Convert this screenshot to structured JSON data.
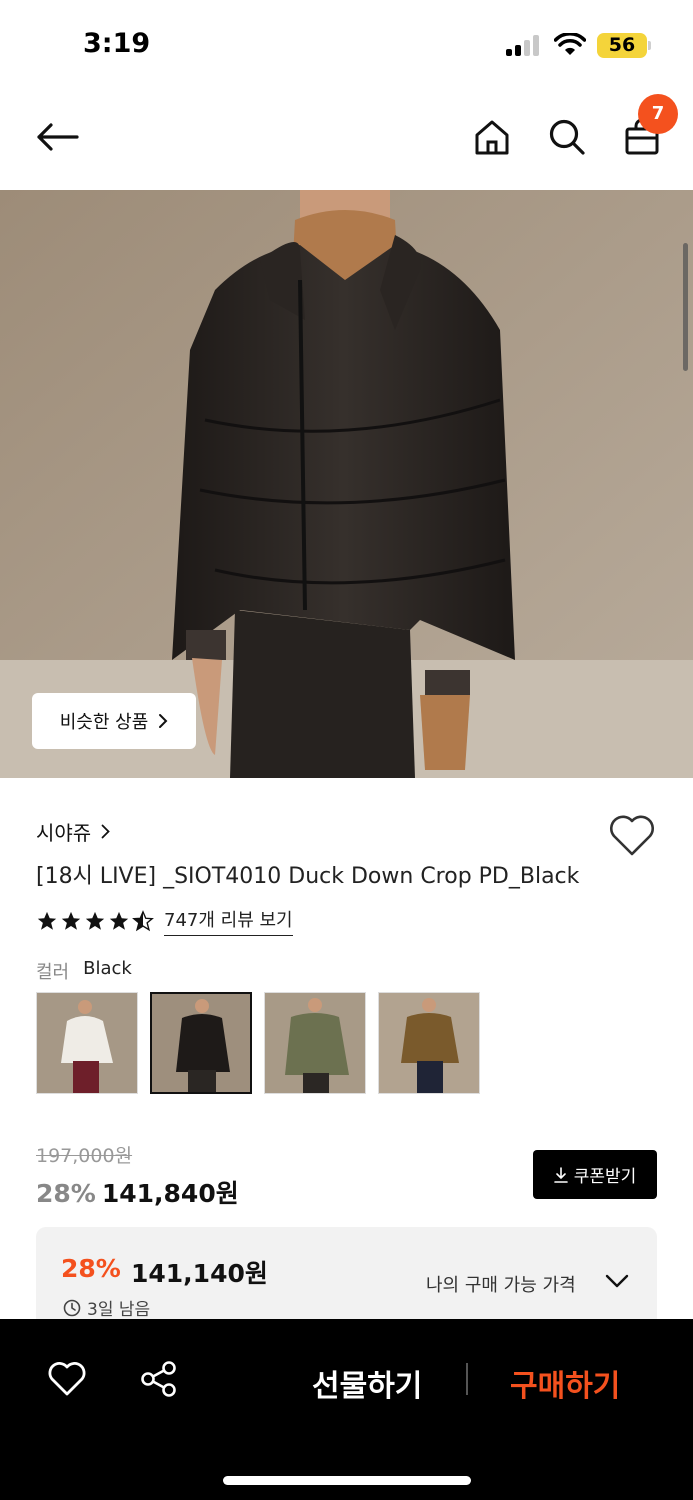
{
  "status_bar": {
    "time": "3:19",
    "battery": "56"
  },
  "header": {
    "back_icon": "arrow-left-icon",
    "home_icon": "home-icon",
    "search_icon": "search-icon",
    "cart_icon": "shopping-bag-icon",
    "cart_count": "7"
  },
  "image": {
    "similar_label": "비슷한 상품"
  },
  "product": {
    "brand": "시야쥬",
    "title": "[18시 LIVE] _SIOT4010 Duck Down Crop PD_Black",
    "rating": 4.5,
    "review_link": "747개 리뷰 보기",
    "color_label": "컬러",
    "color_value": "Black",
    "swatches": [
      "ivory",
      "black",
      "khaki",
      "brown"
    ]
  },
  "pricing": {
    "original": "197,000원",
    "discount": "28%",
    "price": "141,840원",
    "coupon_label": "쿠폰받기",
    "my_price": {
      "discount": "28%",
      "price": "141,140원",
      "label": "나의 구매 가능 가격",
      "timer": "3일 남음"
    }
  },
  "bottom_bar": {
    "gift_label": "선물하기",
    "buy_label": "구매하기"
  },
  "colors": {
    "accent": "#f4511e",
    "badge": "#f4511e",
    "bar": "#000000"
  }
}
